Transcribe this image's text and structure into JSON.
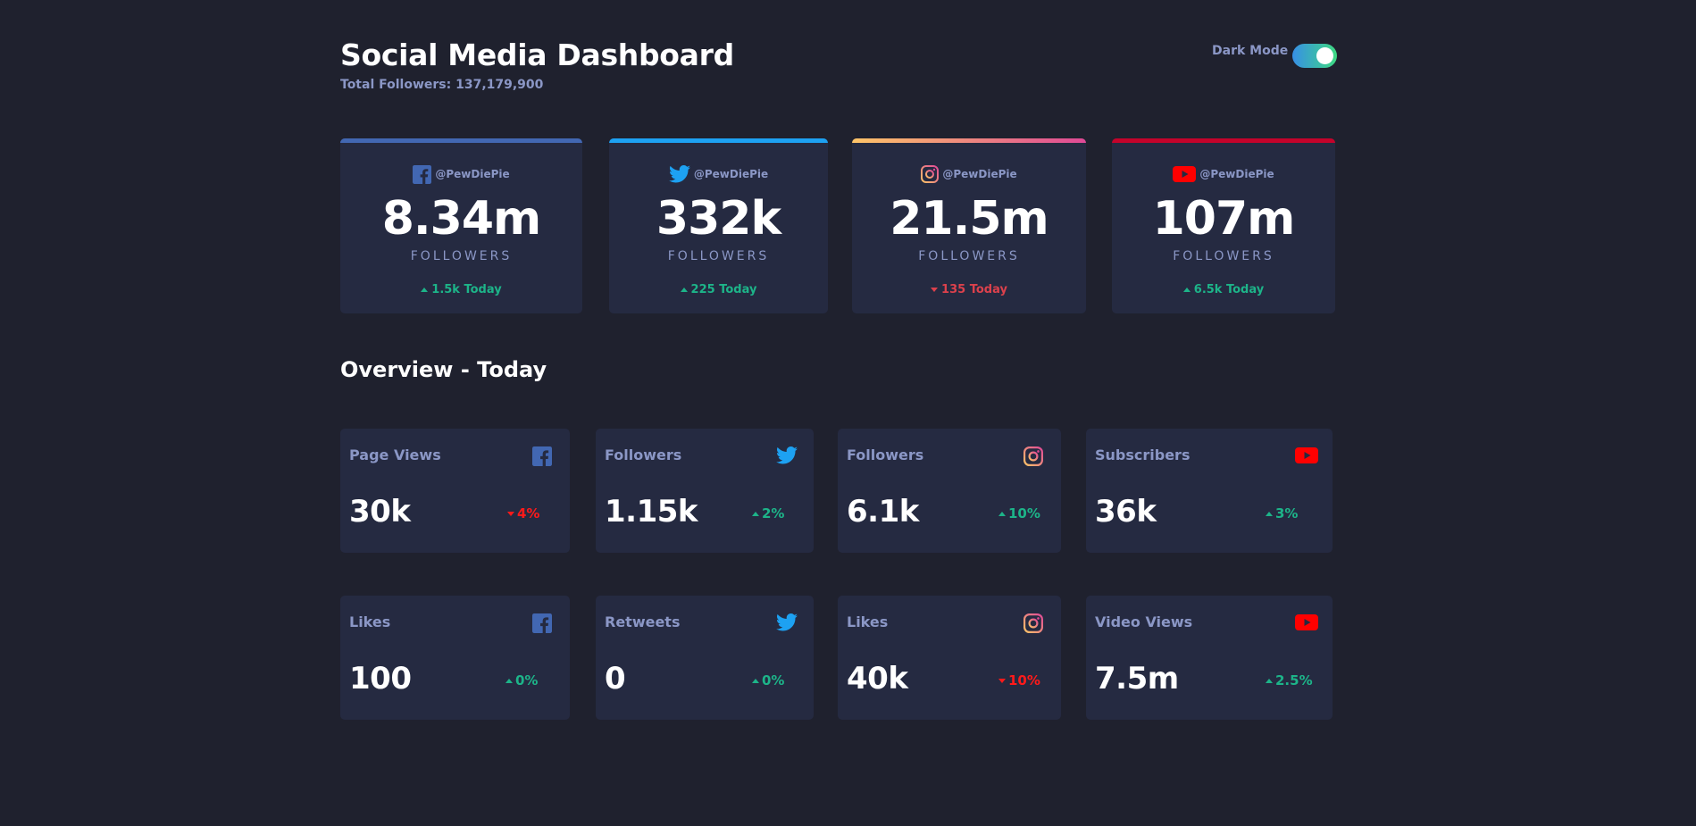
{
  "header": {
    "title": "Social Media Dashboard",
    "total_followers": "Total Followers: 137,179,900",
    "dark_mode_label": "Dark Mode",
    "dark_mode_on": true
  },
  "colors": {
    "background": "#1f212e",
    "card": "#252a41",
    "muted_text": "#8b97c6",
    "up": "#1db489",
    "down": "#dc414c",
    "facebook": "#4267b2",
    "twitter": "#1da1f2",
    "instagram_gradient": [
      "#fdc468",
      "#df4996"
    ],
    "youtube": "#ff0000"
  },
  "followers": [
    {
      "platform": "facebook",
      "icon": "facebook-icon",
      "handle": "@PewDiePie",
      "count": "8.34m",
      "unit": "FOLLOWERS",
      "change": "1.5k Today",
      "direction": "up"
    },
    {
      "platform": "twitter",
      "icon": "twitter-icon",
      "handle": "@PewDiePie",
      "count": "332k",
      "unit": "FOLLOWERS",
      "change": "225 Today",
      "direction": "up"
    },
    {
      "platform": "instagram",
      "icon": "instagram-icon",
      "handle": "@PewDiePie",
      "count": "21.5m",
      "unit": "FOLLOWERS",
      "change": "135 Today",
      "direction": "down"
    },
    {
      "platform": "youtube",
      "icon": "youtube-icon",
      "handle": "@PewDiePie",
      "count": "107m",
      "unit": "FOLLOWERS",
      "change": "6.5k Today",
      "direction": "up"
    }
  ],
  "overview": {
    "title": "Overview - Today",
    "cards": [
      {
        "label": "Page Views",
        "icon": "facebook-icon",
        "value": "30k",
        "change": "4%",
        "direction": "down"
      },
      {
        "label": "Followers",
        "icon": "twitter-icon",
        "value": "1.15k",
        "change": "2%",
        "direction": "up"
      },
      {
        "label": "Followers",
        "icon": "instagram-icon",
        "value": "6.1k",
        "change": "10%",
        "direction": "up"
      },
      {
        "label": "Subscribers",
        "icon": "youtube-icon",
        "value": "36k",
        "change": "3%",
        "direction": "up"
      },
      {
        "label": "Likes",
        "icon": "facebook-icon",
        "value": "100",
        "change": "0%",
        "direction": "up"
      },
      {
        "label": "Retweets",
        "icon": "twitter-icon",
        "value": "0",
        "change": "0%",
        "direction": "up"
      },
      {
        "label": "Likes",
        "icon": "instagram-icon",
        "value": "40k",
        "change": "10%",
        "direction": "down"
      },
      {
        "label": "Video Views",
        "icon": "youtube-icon",
        "value": "7.5m",
        "change": "2.5%",
        "direction": "up"
      }
    ]
  }
}
